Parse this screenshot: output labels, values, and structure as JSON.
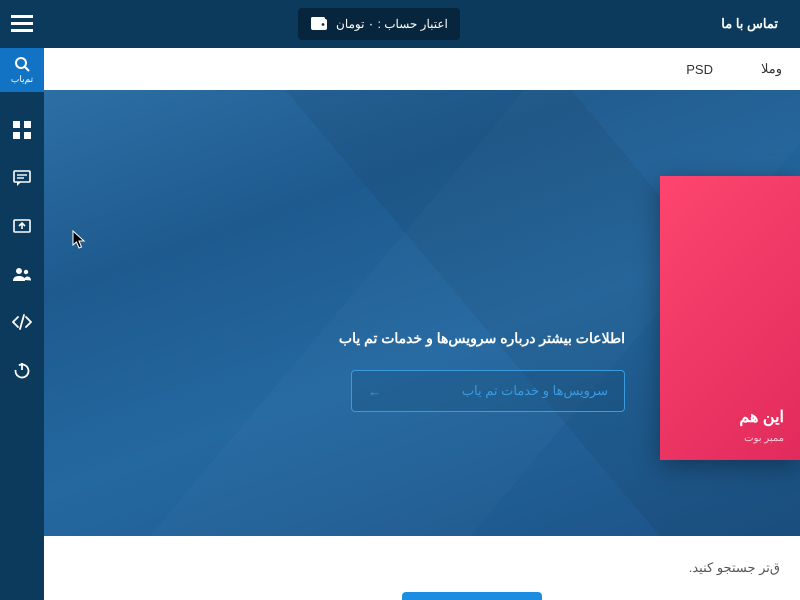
{
  "topbar": {
    "contact": "تماس با ما",
    "credit_label": "اعتبار حساب : ۰ تومان"
  },
  "secondary_nav": {
    "items": [
      "وملا",
      "PSD"
    ]
  },
  "hero": {
    "pink_title": "این هم",
    "pink_sub": "ممبر بوت",
    "info_text": "اطلاعات بیشتر درباره سرویس‌ها و خدمات تم یاب",
    "services_btn": "سرویس‌ها و خدمات تم یاب"
  },
  "bottom": {
    "search_prompt": "ق‌تر جستجو کنید."
  },
  "logo": {
    "text": "تم‌یاب"
  }
}
